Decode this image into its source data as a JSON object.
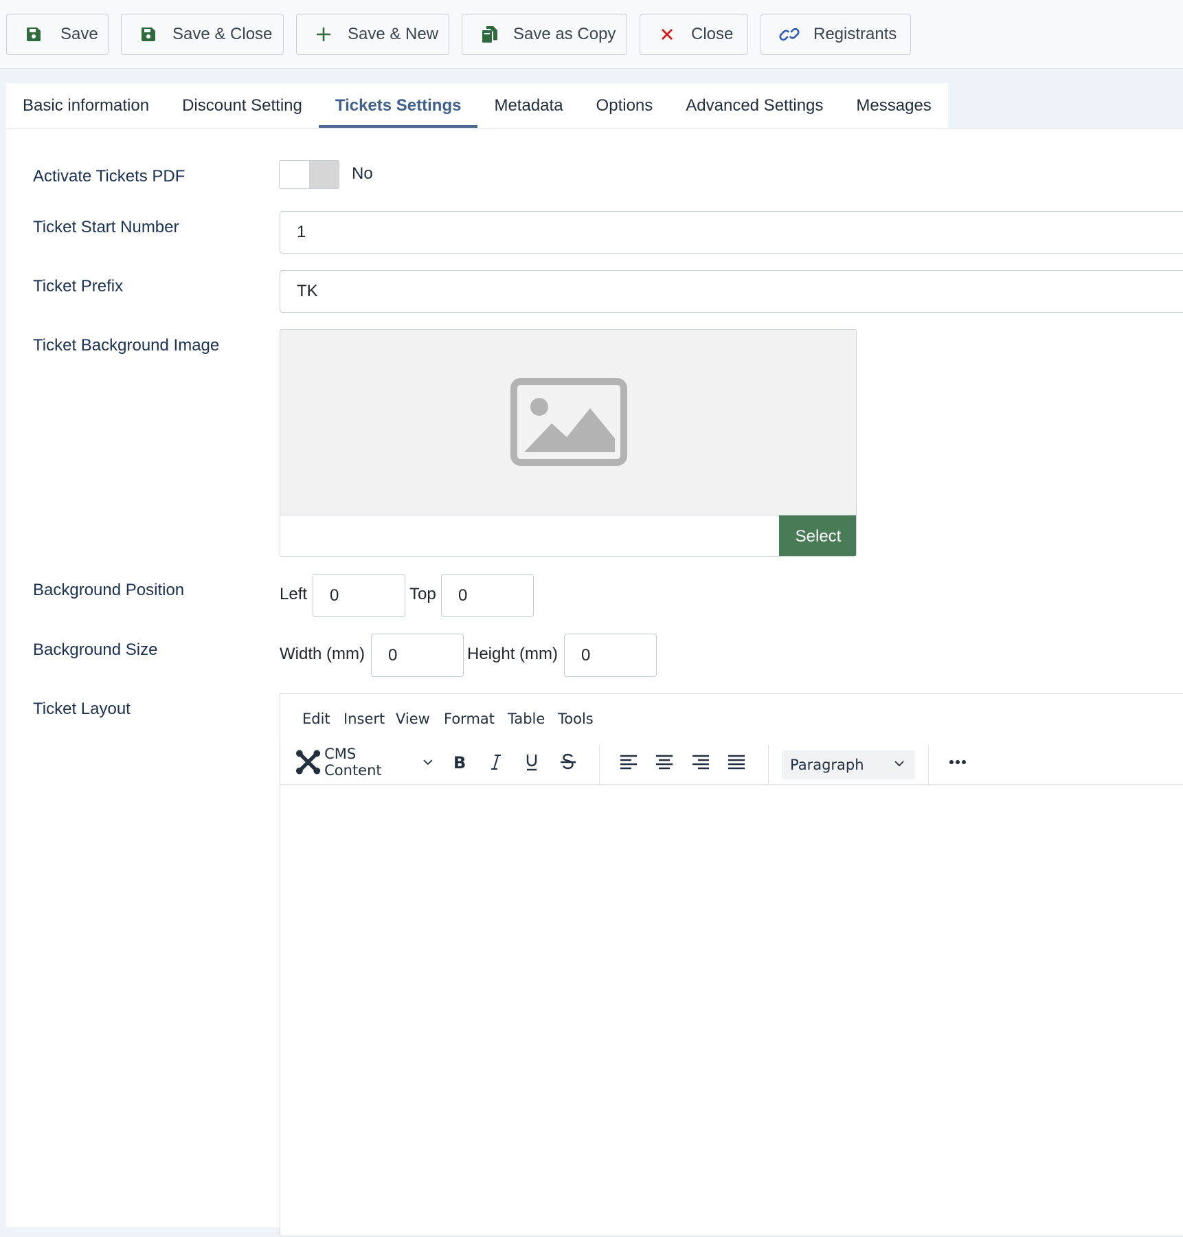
{
  "toolbar": {
    "save": "Save",
    "save_close": "Save & Close",
    "save_new": "Save & New",
    "save_copy": "Save as Copy",
    "close": "Close",
    "registrants": "Registrants"
  },
  "tabs": [
    {
      "label": "Basic information"
    },
    {
      "label": "Discount Setting"
    },
    {
      "label": "Tickets Settings",
      "active": true
    },
    {
      "label": "Metadata"
    },
    {
      "label": "Options"
    },
    {
      "label": "Advanced Settings"
    },
    {
      "label": "Messages"
    }
  ],
  "form": {
    "activate_pdf": {
      "label": "Activate Tickets PDF",
      "state": "No"
    },
    "start_number": {
      "label": "Ticket Start Number",
      "value": "1"
    },
    "prefix": {
      "label": "Ticket Prefix",
      "value": "TK"
    },
    "background_image": {
      "label": "Ticket Background Image",
      "select_label": "Select",
      "value": ""
    },
    "background_position": {
      "label": "Background Position",
      "left_label": "Left",
      "left_value": "0",
      "top_label": "Top",
      "top_value": "0"
    },
    "background_size": {
      "label": "Background Size",
      "width_label": "Width (mm)",
      "width_value": "0",
      "height_label": "Height (mm)",
      "height_value": "0"
    },
    "layout": {
      "label": "Ticket Layout"
    }
  },
  "editor": {
    "menu": [
      "Edit",
      "Insert",
      "View",
      "Format",
      "Table",
      "Tools"
    ],
    "cms_content": "CMS Content",
    "block_format": "Paragraph"
  },
  "colors": {
    "accent": "#4a6a95",
    "select_button": "#4a7b57",
    "close_icon": "#d11a1a",
    "save_icon": "#2f6b3f",
    "label_text": "#1a3154"
  }
}
